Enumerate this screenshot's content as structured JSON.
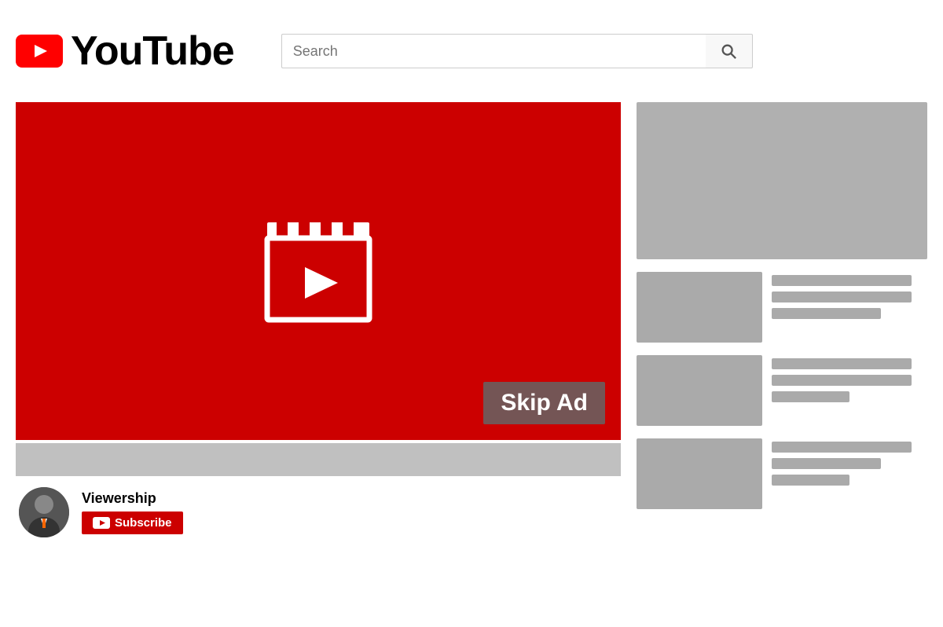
{
  "header": {
    "logo_text": "YouTube",
    "search_placeholder": "Search",
    "search_button_label": "Search"
  },
  "video": {
    "skip_ad_label": "Skip Ad",
    "channel_name": "Viewership",
    "subscribe_label": "Subscribe"
  },
  "sidebar": {
    "items": [
      {
        "id": 1
      },
      {
        "id": 2
      },
      {
        "id": 3
      }
    ]
  }
}
